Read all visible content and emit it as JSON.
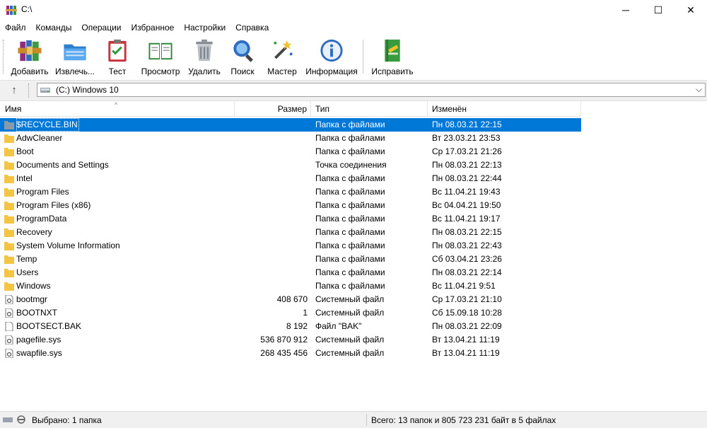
{
  "window": {
    "title": "C:\\",
    "min_glyph": "─",
    "max_glyph": "☐",
    "close_glyph": "✕"
  },
  "menu": [
    "Файл",
    "Команды",
    "Операции",
    "Избранное",
    "Настройки",
    "Справка"
  ],
  "toolbar": [
    {
      "label": "Добавить",
      "icon": "archive-books-icon"
    },
    {
      "label": "Извлечь...",
      "icon": "folder-extract-icon"
    },
    {
      "label": "Тест",
      "icon": "clipboard-check-icon"
    },
    {
      "label": "Просмотр",
      "icon": "open-book-icon"
    },
    {
      "label": "Удалить",
      "icon": "trash-icon"
    },
    {
      "label": "Поиск",
      "icon": "magnifier-icon"
    },
    {
      "label": "Мастер",
      "icon": "magic-wand-icon"
    },
    {
      "label": "Информация",
      "icon": "info-icon"
    },
    {
      "label": "Исправить",
      "icon": "repair-book-icon"
    }
  ],
  "address": {
    "up_glyph": "↑",
    "path": "(C:) Windows 10",
    "chevron": "⌵"
  },
  "columns": {
    "name": "Имя",
    "size": "Размер",
    "type": "Тип",
    "modified": "Изменён",
    "sort_glyph": "^"
  },
  "files": [
    {
      "name": "$RECYCLE.BIN",
      "size": "",
      "type": "Папка с файлами",
      "modified": "Пн 08.03.21 22:15",
      "kind": "folder-gray",
      "selected": true
    },
    {
      "name": "AdwCleaner",
      "size": "",
      "type": "Папка с файлами",
      "modified": "Вт 23.03.21 23:53",
      "kind": "folder"
    },
    {
      "name": "Boot",
      "size": "",
      "type": "Папка с файлами",
      "modified": "Ср 17.03.21 21:26",
      "kind": "folder"
    },
    {
      "name": "Documents and Settings",
      "size": "",
      "type": "Точка соединения",
      "modified": "Пн 08.03.21 22:13",
      "kind": "folder"
    },
    {
      "name": "Intel",
      "size": "",
      "type": "Папка с файлами",
      "modified": "Пн 08.03.21 22:44",
      "kind": "folder"
    },
    {
      "name": "Program Files",
      "size": "",
      "type": "Папка с файлами",
      "modified": "Вс 11.04.21 19:43",
      "kind": "folder"
    },
    {
      "name": "Program Files (x86)",
      "size": "",
      "type": "Папка с файлами",
      "modified": "Вс 04.04.21 19:50",
      "kind": "folder"
    },
    {
      "name": "ProgramData",
      "size": "",
      "type": "Папка с файлами",
      "modified": "Вс 11.04.21 19:17",
      "kind": "folder"
    },
    {
      "name": "Recovery",
      "size": "",
      "type": "Папка с файлами",
      "modified": "Пн 08.03.21 22:15",
      "kind": "folder"
    },
    {
      "name": "System Volume Information",
      "size": "",
      "type": "Папка с файлами",
      "modified": "Пн 08.03.21 22:43",
      "kind": "folder"
    },
    {
      "name": "Temp",
      "size": "",
      "type": "Папка с файлами",
      "modified": "Сб 03.04.21 23:26",
      "kind": "folder"
    },
    {
      "name": "Users",
      "size": "",
      "type": "Папка с файлами",
      "modified": "Пн 08.03.21 22:14",
      "kind": "folder"
    },
    {
      "name": "Windows",
      "size": "",
      "type": "Папка с файлами",
      "modified": "Вс 11.04.21 9:51",
      "kind": "folder"
    },
    {
      "name": "bootmgr",
      "size": "408 670",
      "type": "Системный файл",
      "modified": "Ср 17.03.21 21:10",
      "kind": "sysfile"
    },
    {
      "name": "BOOTNXT",
      "size": "1",
      "type": "Системный файл",
      "modified": "Сб 15.09.18 10:28",
      "kind": "sysfile"
    },
    {
      "name": "BOOTSECT.BAK",
      "size": "8 192",
      "type": "Файл \"BAK\"",
      "modified": "Пн 08.03.21 22:09",
      "kind": "file"
    },
    {
      "name": "pagefile.sys",
      "size": "536 870 912",
      "type": "Системный файл",
      "modified": "Вт 13.04.21 11:19",
      "kind": "sysfile"
    },
    {
      "name": "swapfile.sys",
      "size": "268 435 456",
      "type": "Системный файл",
      "modified": "Вт 13.04.21 11:19",
      "kind": "sysfile"
    }
  ],
  "status": {
    "left": "Выбрано: 1 папка",
    "right": "Всего: 13 папок и 805 723 231 байт в 5 файлах"
  },
  "colors": {
    "selection": "#0078d7",
    "folder": "#f4c542",
    "folder_gray": "#8a9aa8"
  }
}
